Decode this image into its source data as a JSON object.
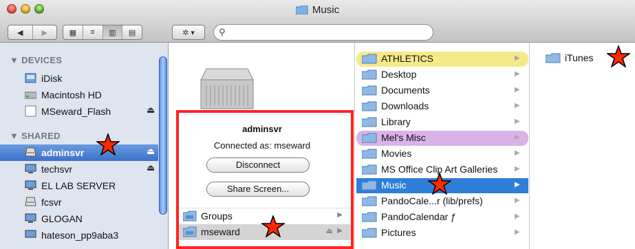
{
  "window": {
    "title": "Music"
  },
  "toolbar": {
    "back": "◀",
    "forward": "▶",
    "view_icon": "▦",
    "view_list": "≡",
    "view_column": "▥",
    "view_coverflow": "▤",
    "action": "✲ ▾",
    "search_placeholder": ""
  },
  "sidebar": {
    "devices_header": "DEVICES",
    "shared_header": "SHARED",
    "devices": [
      {
        "label": "iDisk"
      },
      {
        "label": "Macintosh HD"
      },
      {
        "label": "MSeward_Flash",
        "eject": "⏏"
      }
    ],
    "shared": [
      {
        "label": "adminsvr",
        "eject": "⏏",
        "selected": true
      },
      {
        "label": "techsvr",
        "eject": "⏏"
      },
      {
        "label": "EL LAB SERVER"
      },
      {
        "label": "fcsvr"
      },
      {
        "label": "GLOGAN"
      },
      {
        "label": "hateson_pp9aba3"
      }
    ]
  },
  "server_panel": {
    "name": "adminsvr",
    "connected_as": "Connected as: mseward",
    "disconnect_label": "Disconnect",
    "share_screen_label": "Share Screen...",
    "volumes": [
      {
        "label": "Groups",
        "arrow": "▶"
      },
      {
        "label": "mseward",
        "arrow": "▶",
        "eject": "⏏"
      }
    ]
  },
  "folders": [
    {
      "label": "ATHLETICS",
      "tag": "yellow"
    },
    {
      "label": "Desktop"
    },
    {
      "label": "Documents"
    },
    {
      "label": "Downloads"
    },
    {
      "label": "Library"
    },
    {
      "label": "Mel's Misc",
      "tag": "purple"
    },
    {
      "label": "Movies"
    },
    {
      "label": "MS Office Clip Art Galleries"
    },
    {
      "label": "Music",
      "selected": true
    },
    {
      "label": "PandoCale...r (lib/prefs)"
    },
    {
      "label": "PandoCalendar ƒ"
    },
    {
      "label": "Pictures"
    }
  ],
  "music_contents": [
    {
      "label": "iTunes"
    }
  ],
  "colors": {
    "selection": "#2f7fd8",
    "sidebar_bg": "#dfe5ee",
    "annotation": "#ff2222",
    "star": "#ff2a00"
  }
}
